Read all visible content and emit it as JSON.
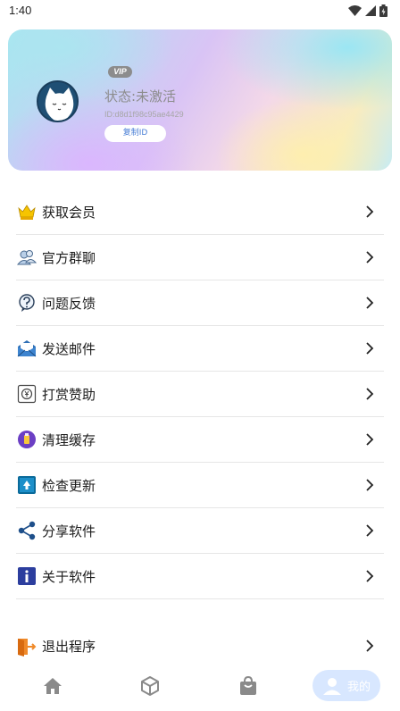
{
  "status_bar": {
    "time": "1:40",
    "icons": [
      "wifi-icon",
      "signal-icon",
      "battery-icon"
    ]
  },
  "profile": {
    "vip_badge": "VIP",
    "status": "状态:未激活",
    "id_text": "ID:d8d1f98c95ae4429",
    "copy_button": "复制ID"
  },
  "menu": {
    "items": [
      {
        "label": "获取会员",
        "icon": "crown-icon"
      },
      {
        "label": "官方群聊",
        "icon": "group-chat-icon"
      },
      {
        "label": "问题反馈",
        "icon": "feedback-icon"
      },
      {
        "label": "发送邮件",
        "icon": "mail-icon"
      },
      {
        "label": "打赏赞助",
        "icon": "donate-icon"
      },
      {
        "label": "清理缓存",
        "icon": "clean-cache-icon"
      },
      {
        "label": "检查更新",
        "icon": "update-icon"
      },
      {
        "label": "分享软件",
        "icon": "share-icon"
      },
      {
        "label": "关于软件",
        "icon": "info-icon"
      }
    ],
    "exit": {
      "label": "退出程序",
      "icon": "exit-icon"
    }
  },
  "bottom_nav": {
    "tabs": [
      "home-icon",
      "cube-icon",
      "shopping-bag-icon"
    ],
    "mine_label": "我的",
    "active": "我的"
  },
  "colors": {
    "accent": "#4a7fd6",
    "nav_active_bg": "#d8e7ff",
    "divider": "#e6e6e6"
  }
}
